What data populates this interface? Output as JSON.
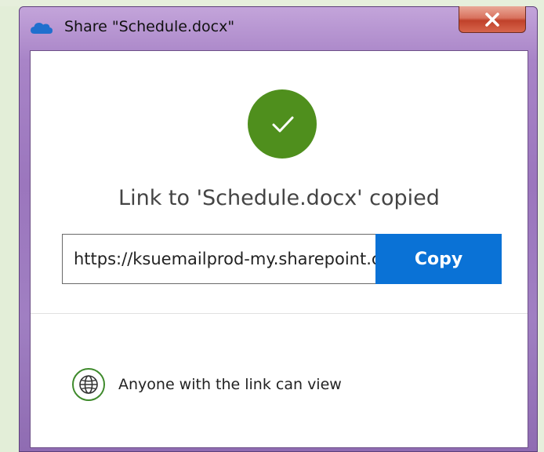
{
  "window": {
    "title": "Share \"Schedule.docx\"",
    "app_icon": "onedrive-cloud-icon",
    "close_icon": "close-icon"
  },
  "status": {
    "icon": "checkmark-icon",
    "message": "Link to 'Schedule.docx' copied"
  },
  "link": {
    "value": "https://ksuemailprod-my.sharepoint.com",
    "copy_label": "Copy"
  },
  "permission": {
    "icon": "globe-icon",
    "label": "Anyone with the link can view"
  },
  "colors": {
    "accent": "#0a72d6",
    "success": "#4f8f1d",
    "window_frame": "#a884c7",
    "close_button": "#c0412a"
  }
}
